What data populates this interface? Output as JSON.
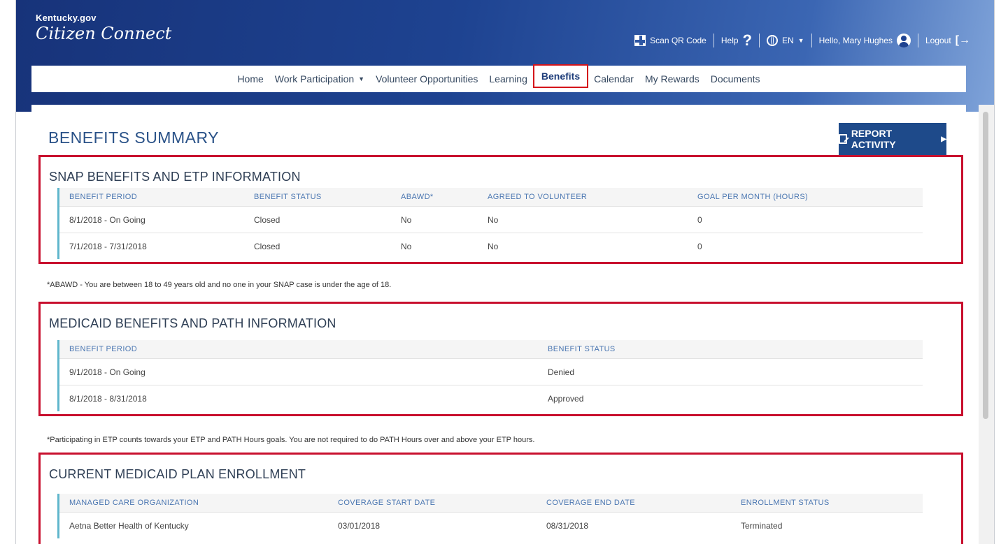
{
  "brand": {
    "top": "Kentucky.gov",
    "script": "Citizen Connect"
  },
  "utility": {
    "scan_qr": "Scan QR Code",
    "help": "Help",
    "help_glyph": "?",
    "lang": "EN",
    "greeting": "Hello, Mary Hughes",
    "logout": "Logout"
  },
  "nav": {
    "items": [
      "Home",
      "Work Participation",
      "Volunteer Opportunities",
      "Learning",
      "Benefits",
      "Calendar",
      "My Rewards",
      "Documents"
    ],
    "active": "Benefits"
  },
  "page": {
    "title": "BENEFITS SUMMARY",
    "report_button": "REPORT ACTIVITY"
  },
  "snap": {
    "title": "SNAP BENEFITS AND ETP INFORMATION",
    "headers": [
      "BENEFIT PERIOD",
      "BENEFIT STATUS",
      "ABAWD*",
      "AGREED TO VOLUNTEER",
      "GOAL PER MONTH (HOURS)"
    ],
    "rows": [
      [
        "8/1/2018 - On Going",
        "Closed",
        "No",
        "No",
        "0"
      ],
      [
        "7/1/2018 - 7/31/2018",
        "Closed",
        "No",
        "No",
        "0"
      ]
    ],
    "note": "*ABAWD - You are between 18 to 49 years old and no one in your SNAP case is under the age of 18."
  },
  "medicaid": {
    "title": "MEDICAID BENEFITS AND PATH INFORMATION",
    "headers": [
      "BENEFIT PERIOD",
      "BENEFIT STATUS"
    ],
    "rows": [
      [
        "9/1/2018 - On Going",
        "Denied"
      ],
      [
        "8/1/2018 - 8/31/2018",
        "Approved"
      ]
    ],
    "note": "*Participating in ETP counts towards your ETP and PATH Hours goals. You are not required to do PATH Hours over and above your ETP hours."
  },
  "enrollment": {
    "title": "CURRENT MEDICAID PLAN ENROLLMENT",
    "headers": [
      "MANAGED CARE ORGANIZATION",
      "COVERAGE START DATE",
      "COVERAGE END DATE",
      "ENROLLMENT STATUS"
    ],
    "rows": [
      [
        "Aetna Better Health of Kentucky",
        "03/01/2018",
        "08/31/2018",
        "Terminated"
      ]
    ]
  },
  "colors": {
    "header": "#1e4391",
    "highlight": "#c8102e",
    "accent": "#5fb6cc",
    "button": "#1e4a8a"
  }
}
